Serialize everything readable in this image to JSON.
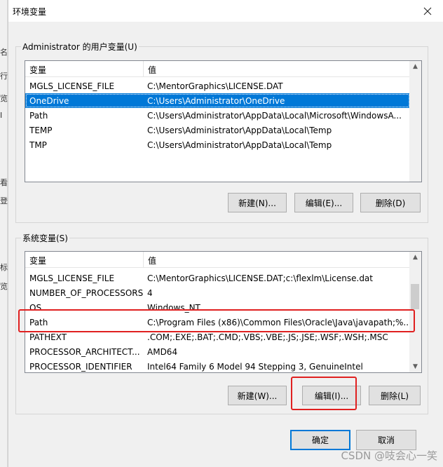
{
  "left_strip": [
    "名",
    "行",
    "览",
    "I",
    "看",
    "登",
    "标",
    "览"
  ],
  "window": {
    "title": "环境变量"
  },
  "user_group": {
    "legend": "Administrator 的用户变量(U)",
    "col_var": "变量",
    "col_val": "值",
    "rows": [
      {
        "name": "MGLS_LICENSE_FILE",
        "value": "C:\\MentorGraphics\\LICENSE.DAT"
      },
      {
        "name": "OneDrive",
        "value": "C:\\Users\\Administrator\\OneDrive"
      },
      {
        "name": "Path",
        "value": "C:\\Users\\Administrator\\AppData\\Local\\Microsoft\\WindowsA..."
      },
      {
        "name": "TEMP",
        "value": "C:\\Users\\Administrator\\AppData\\Local\\Temp"
      },
      {
        "name": "TMP",
        "value": "C:\\Users\\Administrator\\AppData\\Local\\Temp"
      }
    ],
    "selected_index": 1,
    "buttons": {
      "new": "新建(N)...",
      "edit": "编辑(E)...",
      "delete": "删除(D)"
    }
  },
  "system_group": {
    "legend": "系统变量(S)",
    "col_var": "变量",
    "col_val": "值",
    "rows": [
      {
        "name": "MGLS_LICENSE_FILE",
        "value": "C:\\MentorGraphics\\LICENSE.DAT;c:\\flexlm\\License.dat"
      },
      {
        "name": "NUMBER_OF_PROCESSORS",
        "value": "4"
      },
      {
        "name": "OS",
        "value": "Windows_NT"
      },
      {
        "name": "Path",
        "value": "C:\\Program Files (x86)\\Common Files\\Oracle\\Java\\javapath;%..."
      },
      {
        "name": "PATHEXT",
        "value": ".COM;.EXE;.BAT;.CMD;.VBS;.VBE;.JS;.JSE;.WSF;.WSH;.MSC"
      },
      {
        "name": "PROCESSOR_ARCHITECT...",
        "value": "AMD64"
      },
      {
        "name": "PROCESSOR_IDENTIFIER",
        "value": "Intel64 Family 6 Model 94 Stepping 3, GenuineIntel"
      }
    ],
    "buttons": {
      "new": "新建(W)...",
      "edit": "编辑(I)...",
      "delete": "删除(L)"
    }
  },
  "footer": {
    "ok": "确定",
    "cancel": "取消"
  },
  "watermark": "CSDN @吱会心一笑",
  "colors": {
    "selection": "#0078d7",
    "highlight_box": "#e02020"
  }
}
